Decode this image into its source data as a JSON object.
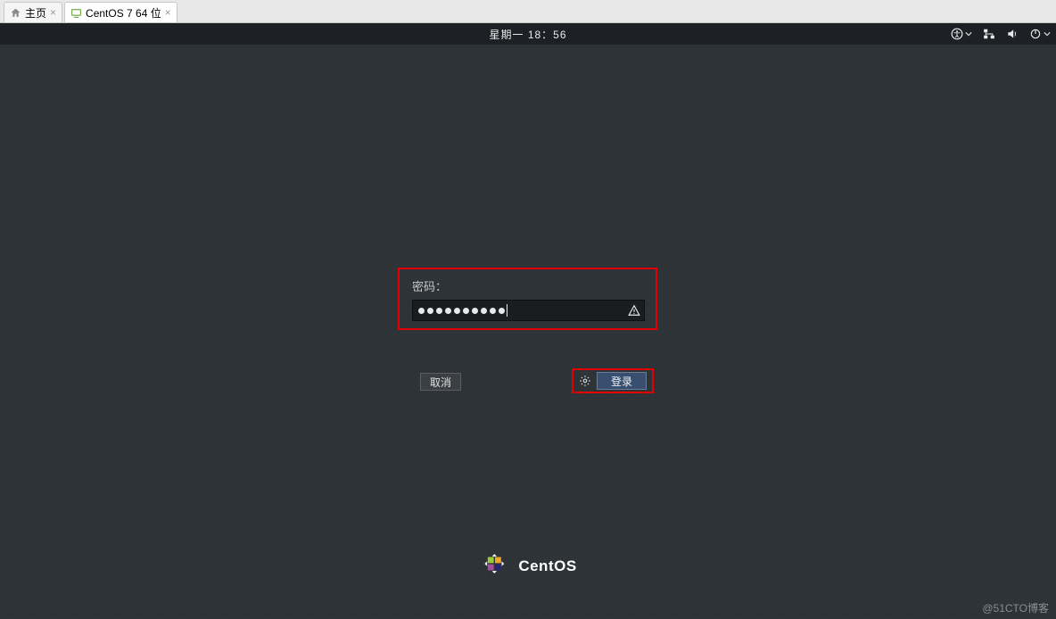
{
  "vm_tabs": {
    "home_label": "主页",
    "vm_label": "CentOS 7 64 位"
  },
  "topbar": {
    "clock": "星期一 18：56"
  },
  "login": {
    "password_label": "密码：",
    "password_dot_count": 10,
    "cancel_label": "取消",
    "login_label": "登录"
  },
  "footer": {
    "os_name": "CentOS"
  },
  "watermark": "@51CTO博客"
}
